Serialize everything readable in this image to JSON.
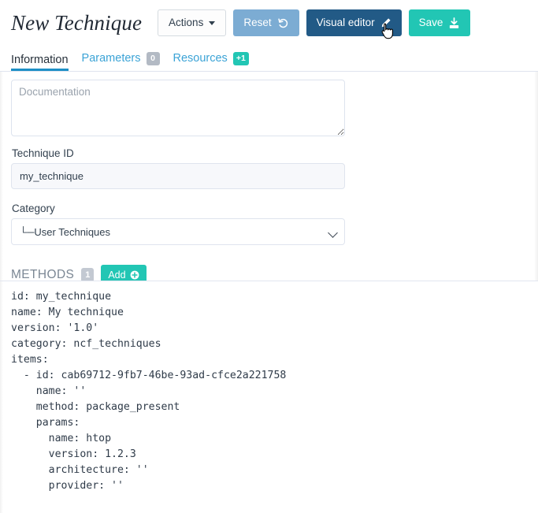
{
  "header": {
    "title": "New Technique",
    "buttons": [
      {
        "label": "Actions",
        "icon": "caret-down-icon",
        "style": "default"
      },
      {
        "label": "Reset",
        "icon": "undo-icon",
        "style": "reset"
      },
      {
        "label": "Visual editor",
        "icon": "pencil-icon",
        "style": "visual"
      },
      {
        "label": "Save",
        "icon": "save-download-icon",
        "style": "save"
      }
    ]
  },
  "tabs": [
    {
      "label": "Information",
      "badge": null,
      "active": true
    },
    {
      "label": "Parameters",
      "badge": "0",
      "badge_style": "gray",
      "active": false
    },
    {
      "label": "Resources",
      "badge": "+1",
      "badge_style": "teal",
      "active": false
    }
  ],
  "form": {
    "documentation": {
      "value": "",
      "placeholder": "Documentation"
    },
    "technique_id": {
      "label": "Technique ID",
      "value": "my_technique"
    },
    "category": {
      "label": "Category",
      "selected": "└─User Techniques",
      "options": [
        "└─User Techniques"
      ]
    }
  },
  "methods": {
    "title": "METHODS",
    "count": "1",
    "add_label": "Add"
  },
  "yaml": {
    "content": "id: my_technique\nname: My technique\nversion: '1.0'\ncategory: ncf_techniques\nitems:\n  - id: cab69712-9fb7-46be-93ad-cfce2a221758\n    name: ''\n    method: package_present\n    params:\n      name: htop\n      version: 1.2.3\n      architecture: ''\n      provider: ''"
  },
  "colors": {
    "teal": "#22c6b4",
    "dark_blue": "#225a86",
    "light_blue": "#7cacd3",
    "tab_link": "#3ba3d6",
    "tab_underline": "#1d8fc6",
    "badge_gray": "#b3bac4"
  }
}
